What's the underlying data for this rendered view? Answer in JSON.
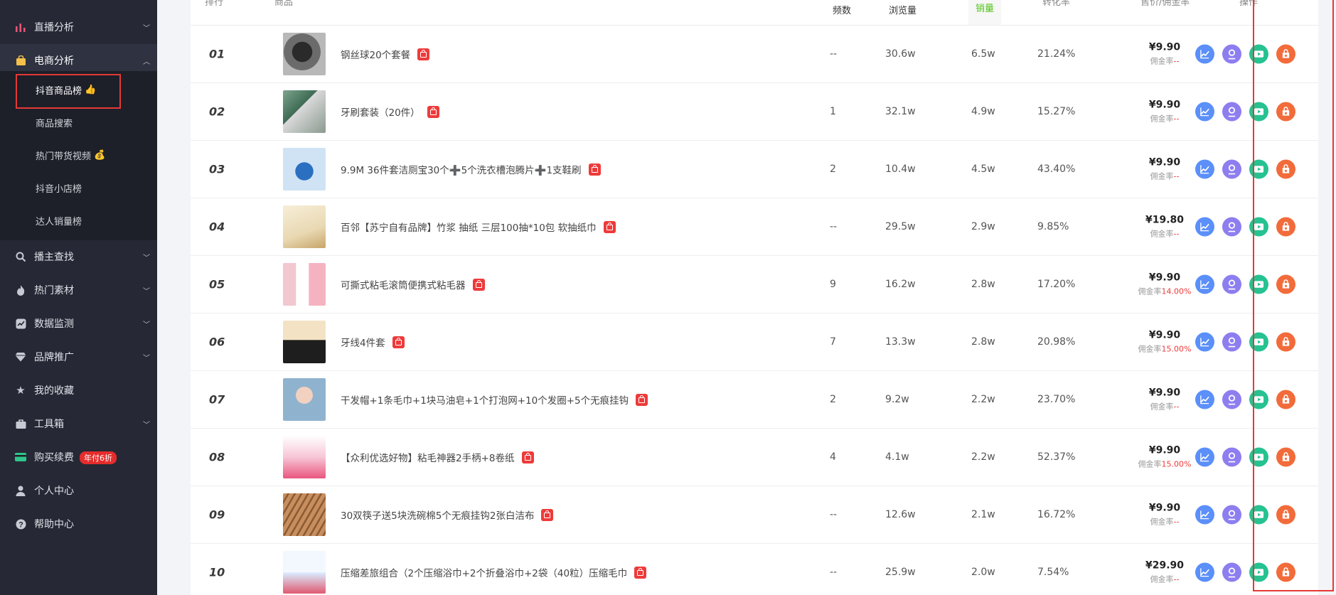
{
  "sidebar": {
    "live": "直播分析",
    "ecom": "电商分析",
    "sub": [
      "抖音商品榜",
      "商品搜索",
      "热门带货视频",
      "抖音小店榜",
      "达人销量榜"
    ],
    "sub_emojis": [
      "👍",
      "",
      "💰",
      "",
      ""
    ],
    "anchor": "播主查找",
    "material": "热门素材",
    "monitor": "数据监测",
    "brand": "品牌推广",
    "favorites": "我的收藏",
    "tools": "工具箱",
    "buy": "购买续费",
    "buy_badge": "年付6折",
    "profile": "个人中心",
    "help": "帮助中心"
  },
  "table": {
    "header": {
      "rank": "排行",
      "product": "商品",
      "freq": "频数",
      "views": "浏览量",
      "sales": "销量",
      "conv": "转化率",
      "price": "售价/佣金率",
      "ops": "操作"
    },
    "comm_label": "佣金率",
    "rows": [
      {
        "rank": "01",
        "name": "钢丝球20个套餐",
        "freq": "--",
        "views": "30.6w",
        "sales": "6.5w",
        "conv": "21.24%",
        "price": "¥9.90",
        "comm": "--"
      },
      {
        "rank": "02",
        "name": "牙刷套装（20件）",
        "freq": "1",
        "views": "32.1w",
        "sales": "4.9w",
        "conv": "15.27%",
        "price": "¥9.90",
        "comm": "--"
      },
      {
        "rank": "03",
        "name": "9.9M 36件套洁厕宝30个➕5个洗衣槽泡腾片➕1支鞋刷",
        "freq": "2",
        "views": "10.4w",
        "sales": "4.5w",
        "conv": "43.40%",
        "price": "¥9.90",
        "comm": "--"
      },
      {
        "rank": "04",
        "name": "百邻【苏宁自有品牌】竹浆 抽纸 三层100抽*10包 软抽纸巾",
        "freq": "--",
        "views": "29.5w",
        "sales": "2.9w",
        "conv": "9.85%",
        "price": "¥19.80",
        "comm": "--"
      },
      {
        "rank": "05",
        "name": "可撕式粘毛滚筒便携式粘毛器",
        "freq": "9",
        "views": "16.2w",
        "sales": "2.8w",
        "conv": "17.20%",
        "price": "¥9.90",
        "comm": "14.00%"
      },
      {
        "rank": "06",
        "name": "牙线4件套",
        "freq": "7",
        "views": "13.3w",
        "sales": "2.8w",
        "conv": "20.98%",
        "price": "¥9.90",
        "comm": "15.00%"
      },
      {
        "rank": "07",
        "name": "干发帽+1条毛巾+1块马油皂+1个打泡网+10个发圈+5个无痕挂钩",
        "freq": "2",
        "views": "9.2w",
        "sales": "2.2w",
        "conv": "23.70%",
        "price": "¥9.90",
        "comm": "--"
      },
      {
        "rank": "08",
        "name": "【众利优选好物】粘毛神器2手柄+8卷纸",
        "freq": "4",
        "views": "4.1w",
        "sales": "2.2w",
        "conv": "52.37%",
        "price": "¥9.90",
        "comm": "15.00%"
      },
      {
        "rank": "09",
        "name": "30双筷子送5块洗碗棉5个无痕挂钩2张白洁布",
        "freq": "--",
        "views": "12.6w",
        "sales": "2.1w",
        "conv": "16.72%",
        "price": "¥9.90",
        "comm": "--"
      },
      {
        "rank": "10",
        "name": "压缩差旅组合（2个压缩浴巾+2个折叠浴巾+2袋（40粒）压缩毛巾",
        "freq": "--",
        "views": "25.9w",
        "sales": "2.0w",
        "conv": "7.54%",
        "price": "¥29.90",
        "comm": "--"
      }
    ]
  },
  "colors": {
    "sidebar_bg": "#262935",
    "highlight_red": "#e53935",
    "sales_header_green": "#52c41a",
    "op_blue": "#5b8ff9",
    "op_purple": "#8d7ef0",
    "op_green": "#26c291",
    "op_orange": "#f26b3a"
  },
  "icons": {
    "row_actions": [
      "trend-chart-icon",
      "influencer-icon",
      "video-play-icon",
      "shop-icon"
    ]
  }
}
